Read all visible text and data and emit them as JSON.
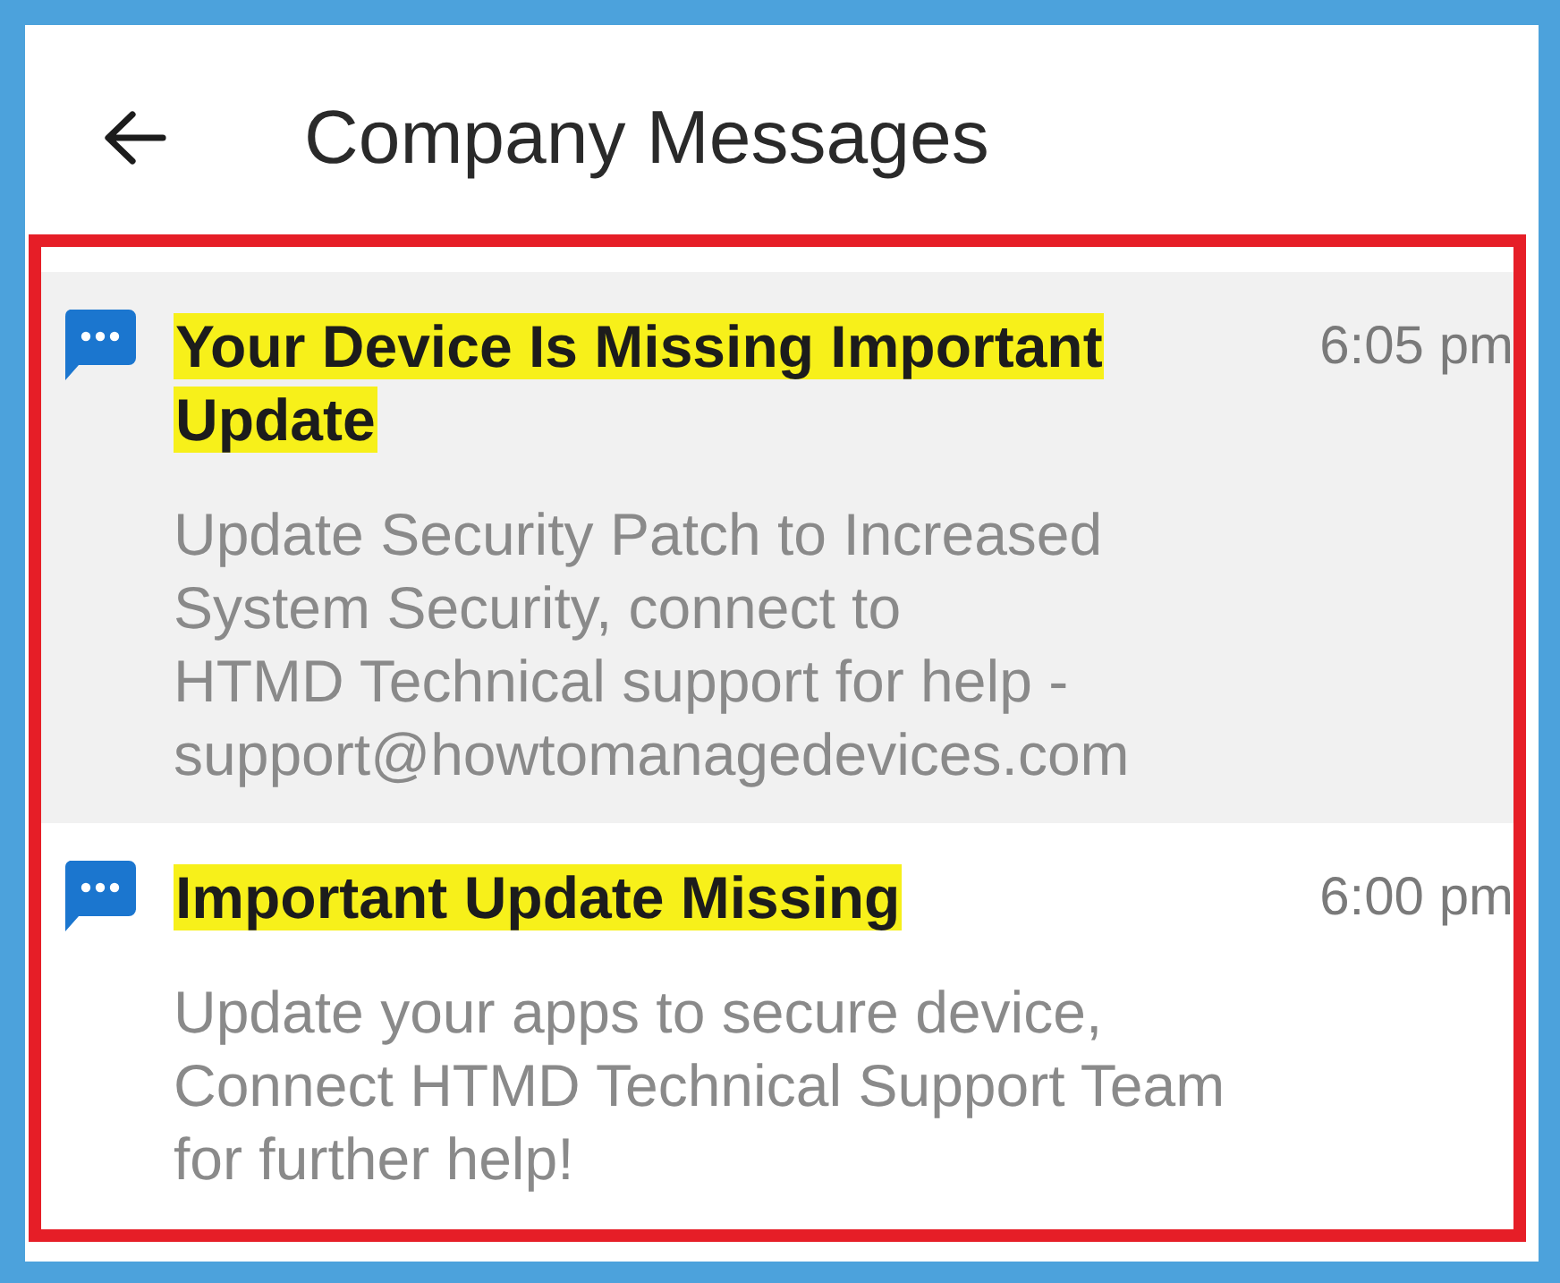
{
  "header": {
    "title": "Company Messages"
  },
  "messages": [
    {
      "title": "Your Device Is Missing Important Update",
      "time": "6:05 pm",
      "body": "Update Security Patch to Increased\nSystem Security, connect to\nHTMD Technical support for help -\nsupport@howtomanagedevices.com",
      "selected": true,
      "highlighted": true
    },
    {
      "title": "Important Update Missing",
      "time": "6:00 pm",
      "body": "Update your apps to secure device,\nConnect HTMD Technical Support Team\nfor further help!",
      "selected": false,
      "highlighted": true
    }
  ]
}
